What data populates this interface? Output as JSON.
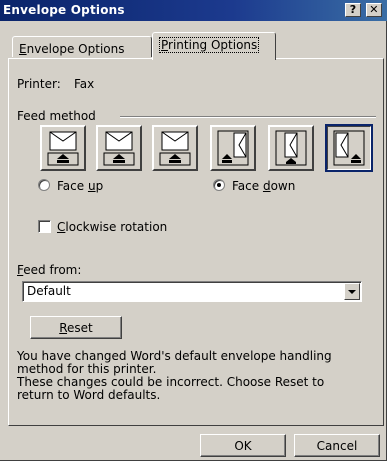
{
  "window": {
    "title": "Envelope Options",
    "help_glyph": "?",
    "close_glyph": "✕"
  },
  "tabs": [
    {
      "label": "Envelope Options",
      "hotkey_index": 0,
      "active": false
    },
    {
      "label": "Printing Options",
      "hotkey_index": 0,
      "active": true
    }
  ],
  "printer": {
    "label": "Printer:",
    "value": "Fax"
  },
  "feed_method": {
    "label": "Feed method",
    "options": [
      {
        "name": "face-up-horizontal-left",
        "selected": false
      },
      {
        "name": "face-up-horizontal-center",
        "selected": false
      },
      {
        "name": "face-up-horizontal-right",
        "selected": false
      },
      {
        "name": "face-up-vertical-left",
        "selected": false
      },
      {
        "name": "face-up-vertical-center",
        "selected": false
      },
      {
        "name": "face-up-vertical-right",
        "selected": true
      }
    ]
  },
  "face": {
    "up": {
      "pre": "Face ",
      "hot": "u",
      "post": "p",
      "selected": false
    },
    "down": {
      "pre": "Face ",
      "hot": "d",
      "post": "own",
      "selected": true
    }
  },
  "clockwise": {
    "hot": "C",
    "rest": "lockwise rotation",
    "checked": false
  },
  "feed_from": {
    "hot": "F",
    "rest": "eed from:",
    "value": "Default"
  },
  "reset": {
    "hot": "R",
    "rest": "eset"
  },
  "message": {
    "line1": "You have changed Word's default envelope handling",
    "line2": "method for this printer.",
    "line3": "These changes could be incorrect. Choose Reset to",
    "line4": "return to Word defaults."
  },
  "buttons": {
    "ok": "OK",
    "cancel": "Cancel"
  },
  "colors": {
    "titlebar": "#0a246a",
    "face": "#d4d0c8",
    "selection": "#0a246a"
  }
}
